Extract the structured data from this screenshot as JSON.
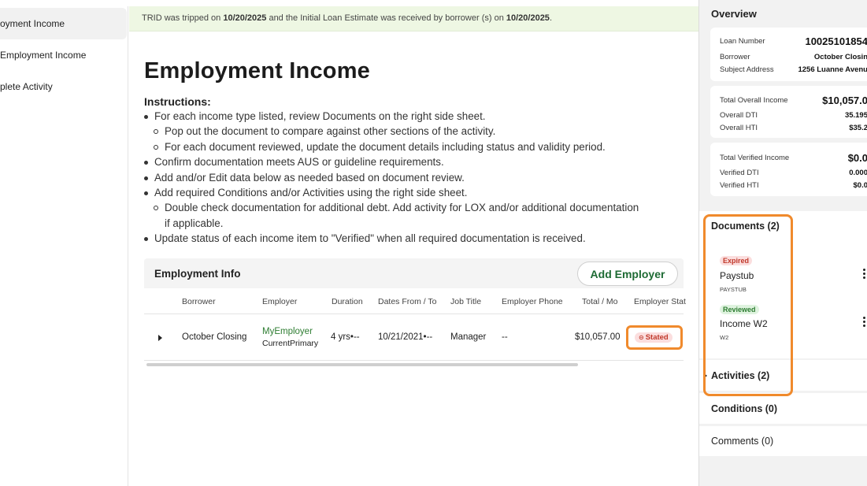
{
  "nav": {
    "items": [
      {
        "label": "oyment Income",
        "active": true
      },
      {
        "label": "Employment Income",
        "active": false
      },
      {
        "label": "plete Activity",
        "active": false
      }
    ]
  },
  "banner": {
    "prefix": "TRID was tripped on ",
    "tripped_date": "10/20/2025",
    "middle": " and the Initial Loan Estimate was received by borrower (s) on ",
    "received_date": "10/20/2025",
    "suffix": "."
  },
  "page": {
    "title": "Employment Income",
    "instructions_heading": "Instructions:",
    "instructions": [
      {
        "level": 1,
        "text": "For each income type listed, review Documents on the right side sheet."
      },
      {
        "level": 2,
        "text": "Pop out the document to compare against other sections of the activity."
      },
      {
        "level": 2,
        "text": "For each document reviewed, update the document details including status and validity period."
      },
      {
        "level": 1,
        "text": "Confirm documentation meets AUS or guideline requirements."
      },
      {
        "level": 1,
        "text": "Add and/or Edit data below as needed based on document review."
      },
      {
        "level": 1,
        "text": "Add required Conditions and/or Activities using the right side sheet."
      },
      {
        "level": 2,
        "text": "Double check documentation for additional debt. Add activity for LOX and/or additional documentation"
      },
      {
        "level": 3,
        "text": "if applicable."
      },
      {
        "level": 1,
        "text": "Update status of each income item to \"Verified\" when all required documentation is received."
      }
    ]
  },
  "employment": {
    "title": "Employment Info",
    "add_button": "Add Employer",
    "columns": [
      "Borrower",
      "Employer",
      "Duration",
      "Dates From / To",
      "Job Title",
      "Employer Phone",
      "Total / Mo",
      "Employer Stat"
    ],
    "rows": [
      {
        "borrower": "October Closing",
        "employer": "MyEmployer",
        "employer_sub": "CurrentPrimary",
        "duration": "4 yrs•--",
        "dates": "10/21/2021•--",
        "job_title": "Manager",
        "phone": "--",
        "total": "$10,057.00",
        "status": "Stated"
      }
    ]
  },
  "overview": {
    "title": "Overview",
    "loan_number_label": "Loan Number",
    "loan_number": "10025101854",
    "borrower_label": "Borrower",
    "borrower": "October Closin",
    "address_label": "Subject Address",
    "address": "1256 Luanne Avenu",
    "total_income_label": "Total Overall Income",
    "total_income": "$10,057.0",
    "overall_dti_label": "Overall DTI",
    "overall_dti": "35.195",
    "overall_hti_label": "Overall HTI",
    "overall_hti": "$35.2",
    "verified_income_label": "Total Verified Income",
    "verified_income": "$0.0",
    "verified_dti_label": "Verified DTI",
    "verified_dti": "0.000",
    "verified_hti_label": "Verified HTI",
    "verified_hti": "$0.0"
  },
  "documents": {
    "title": "Documents (2)",
    "items": [
      {
        "badge": "Expired",
        "name": "Paystub",
        "type": "PAYSTUB"
      },
      {
        "badge": "Reviewed",
        "name": "Income W2",
        "type": "W2"
      }
    ]
  },
  "activities": {
    "title": "Activities (2)"
  },
  "conditions": {
    "title": "Conditions (0)"
  },
  "comments": {
    "title": "Comments (0)"
  },
  "colors": {
    "accent_green": "#1e6b34",
    "highlight_orange": "#f08a2c",
    "banner_bg": "#eef7e3"
  }
}
